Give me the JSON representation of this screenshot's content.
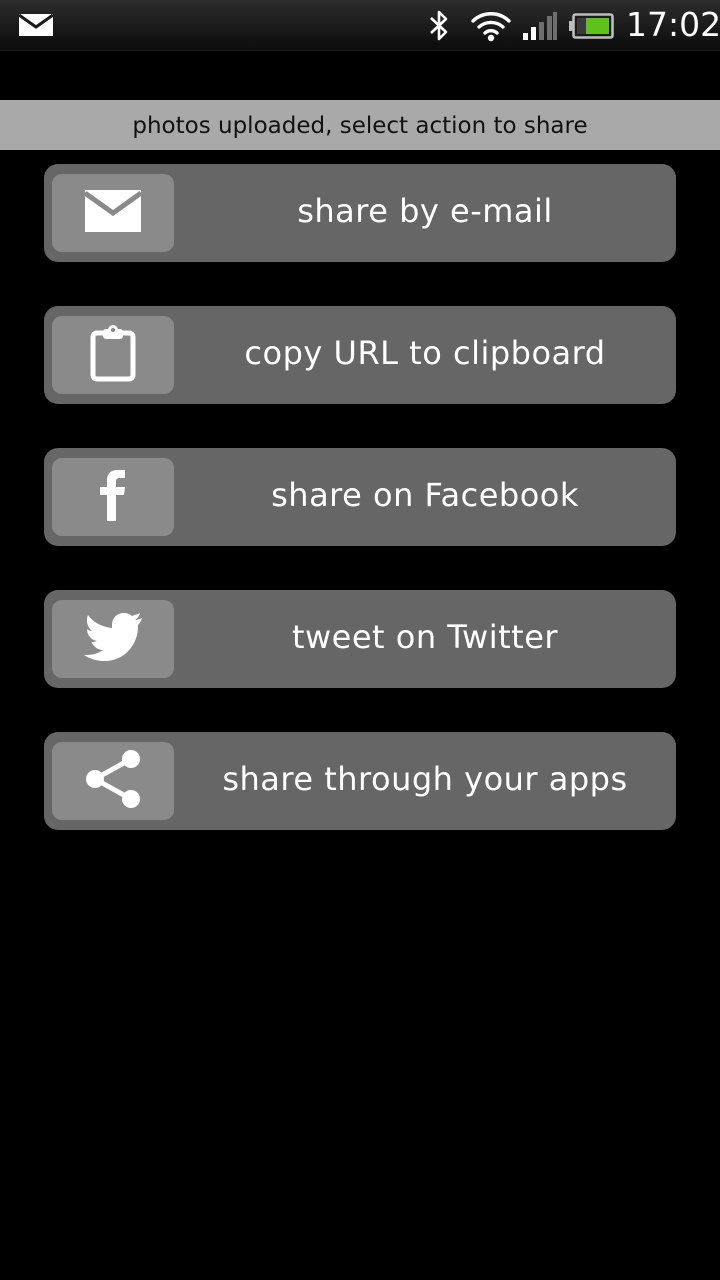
{
  "status_bar": {
    "time": "17:02",
    "icons": [
      "mail-icon",
      "bluetooth-icon",
      "wifi-icon",
      "signal-icon",
      "battery-icon"
    ],
    "battery_color": "#5ec21a"
  },
  "banner": {
    "text": "photos uploaded, select action to share"
  },
  "actions": [
    {
      "label": "share by e-mail",
      "icon": "mail-icon"
    },
    {
      "label": "copy URL to clipboard",
      "icon": "clipboard-icon"
    },
    {
      "label": "share on Facebook",
      "icon": "facebook-icon"
    },
    {
      "label": "tweet on Twitter",
      "icon": "twitter-icon"
    },
    {
      "label": "share through your apps",
      "icon": "share-icon"
    }
  ],
  "colors": {
    "background": "#000000",
    "banner": "#a9a9a9",
    "button": "#666666",
    "icon_box": "#8a8a8a"
  }
}
